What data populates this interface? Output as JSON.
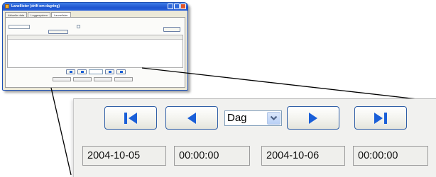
{
  "thumbnail": {
    "title": "Lanellister (drift om dagring)",
    "tabs": [
      "Aktuelle data",
      "Loggesystem",
      "Lannelister"
    ]
  },
  "navigation": {
    "first_icon": "skip-to-first-icon",
    "prev_icon": "previous-triangle-icon",
    "next_icon": "next-triangle-icon",
    "last_icon": "skip-to-last-icon",
    "period_selected": "Dag",
    "period_dropdown_icon": "chevron-down-icon"
  },
  "range": {
    "start_date": "2004-10-05",
    "start_time": "00:00:00",
    "end_date": "2004-10-06",
    "end_time": "00:00:00"
  },
  "colors": {
    "accent_blue": "#1a5fd8",
    "button_border": "#2f5ea6",
    "panel_background": "#f1f1ef"
  }
}
